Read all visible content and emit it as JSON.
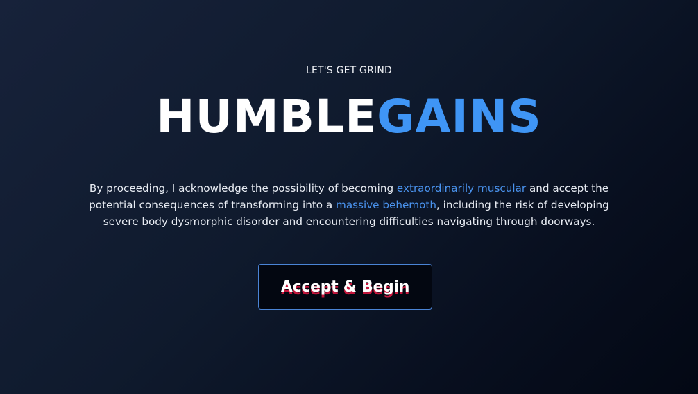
{
  "hero": {
    "eyebrow": "LET'S GET GRIND",
    "brand_part1": "HUMBLE",
    "brand_part2": "GAINS",
    "description": {
      "t1": "By proceeding, I acknowledge the possibility of becoming ",
      "h1": "extraordinarily muscular",
      "t2": " and accept the potential consequences of transforming into a ",
      "h2": "massive behemoth",
      "t3": ", including the risk of developing severe body dysmorphic disorder and encountering difficulties navigating through doorways."
    },
    "cta_label": "Accept & Begin"
  },
  "colors": {
    "accent": "#3f95f5",
    "cta_shadow": "#c5163c",
    "background": "#0f1a2d"
  }
}
